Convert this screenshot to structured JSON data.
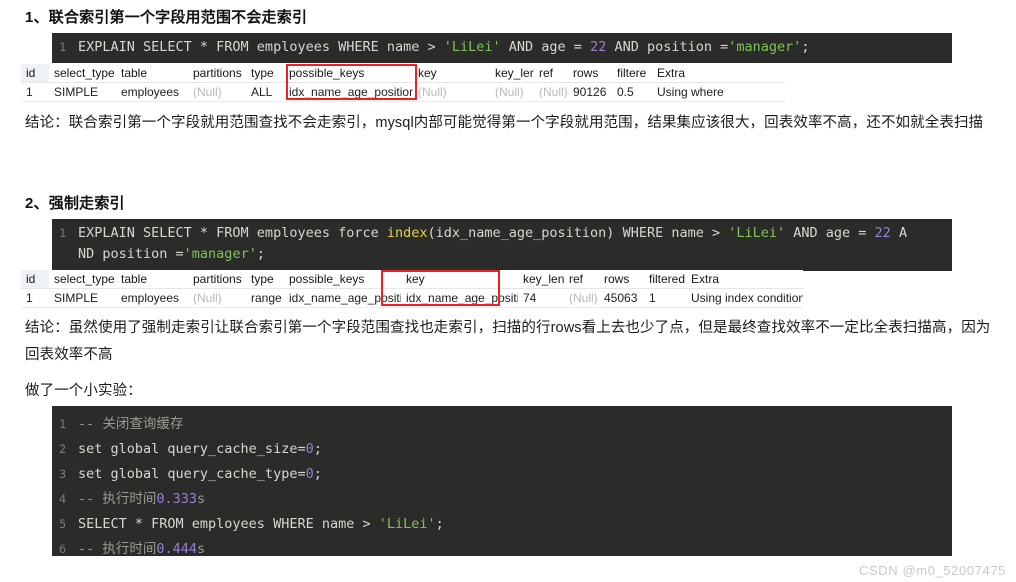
{
  "sections": [
    {
      "heading": "1、联合索引第一个字段用范围不会走索引",
      "code": {
        "lines": [
          {
            "no": "1",
            "parts": [
              {
                "t": "EXPLAIN SELECT * FROM employees WHERE name > ",
                "c": "plain"
              },
              {
                "t": "'LiLei'",
                "c": "str"
              },
              {
                "t": " AND age = ",
                "c": "plain"
              },
              {
                "t": "22",
                "c": "num"
              },
              {
                "t": " AND position =",
                "c": "plain"
              },
              {
                "t": "'manager'",
                "c": "str"
              },
              {
                "t": ";",
                "c": "plain"
              }
            ]
          }
        ]
      },
      "table": {
        "columns": [
          "id",
          "select_type",
          "table",
          "partitions",
          "type",
          "possible_keys",
          "key",
          "key_len",
          "ref",
          "rows",
          "filtere",
          "Extra"
        ],
        "row": [
          "1",
          "SIMPLE",
          "employees",
          "(Null)",
          "ALL",
          "idx_name_age_position",
          "(Null)",
          "(Null)",
          "(Null)",
          "90126",
          "0.5",
          "Using where"
        ],
        "highlighted_column": "possible_keys"
      },
      "conclusion": "结论：联合索引第一个字段就用范围查找不会走索引，mysql内部可能觉得第一个字段就用范围，结果集应该很大，回表效率不高，还不如就全表扫描"
    },
    {
      "heading": "2、强制走索引",
      "code": {
        "lines": [
          {
            "no": "1",
            "parts": [
              {
                "t": "EXPLAIN SELECT * FROM employees force ",
                "c": "plain"
              },
              {
                "t": "index",
                "c": "fn"
              },
              {
                "t": "(idx_name_age_position) WHERE name > ",
                "c": "plain"
              },
              {
                "t": "'LiLei'",
                "c": "str"
              },
              {
                "t": " AND age = ",
                "c": "plain"
              },
              {
                "t": "22",
                "c": "num"
              },
              {
                "t": " A",
                "c": "plain"
              }
            ]
          },
          {
            "no": "",
            "parts": [
              {
                "t": "ND position =",
                "c": "plain"
              },
              {
                "t": "'manager'",
                "c": "str"
              },
              {
                "t": ";",
                "c": "plain"
              }
            ]
          }
        ]
      },
      "table": {
        "columns": [
          "id",
          "select_type",
          "table",
          "partitions",
          "type",
          "possible_keys",
          "key",
          "key_len",
          "ref",
          "rows",
          "filtered",
          "Extra"
        ],
        "row": [
          "1",
          "SIMPLE",
          "employees",
          "(Null)",
          "range",
          "idx_name_age_position",
          "idx_name_age_position",
          "74",
          "(Null)",
          "45063",
          "1",
          "Using index condition"
        ],
        "highlighted_column": "key"
      },
      "conclusion": "结论：虽然使用了强制走索引让联合索引第一个字段范围查找也走索引，扫描的行rows看上去也少了点，但是最终查找效率不一定比全表扫描高，因为回表效率不高",
      "note": "做了一个小实验："
    }
  ],
  "experiment_code": {
    "lines": [
      {
        "no": "1",
        "parts": [
          {
            "t": "-- 关闭查询缓存",
            "c": "cmt"
          }
        ]
      },
      {
        "no": "2",
        "parts": [
          {
            "t": "set global query_cache_size=",
            "c": "plain"
          },
          {
            "t": "0",
            "c": "num"
          },
          {
            "t": ";",
            "c": "plain"
          }
        ]
      },
      {
        "no": "3",
        "parts": [
          {
            "t": "set global query_cache_type=",
            "c": "plain"
          },
          {
            "t": "0",
            "c": "num"
          },
          {
            "t": ";",
            "c": "plain"
          }
        ]
      },
      {
        "no": "4",
        "parts": [
          {
            "t": "-- 执行时间",
            "c": "cmt"
          },
          {
            "t": "0.333",
            "c": "num"
          },
          {
            "t": "s",
            "c": "cmt"
          }
        ]
      },
      {
        "no": "5",
        "parts": [
          {
            "t": "SELECT * FROM employees WHERE name > ",
            "c": "plain"
          },
          {
            "t": "'LiLei'",
            "c": "str"
          },
          {
            "t": ";",
            "c": "plain"
          }
        ]
      },
      {
        "no": "6",
        "parts": [
          {
            "t": "-- 执行时间",
            "c": "cmt"
          },
          {
            "t": "0.444",
            "c": "num"
          },
          {
            "t": "s",
            "c": "cmt"
          }
        ]
      }
    ]
  },
  "watermark": "CSDN @m0_52007475",
  "colors": {
    "code_bg": "#2b2b2a",
    "highlight_red": "#ee2020",
    "string_green": "#80c25a",
    "number_purple": "#9a7fd6",
    "function_yellow": "#e8d04a",
    "comment_gray": "#9b9b92"
  }
}
